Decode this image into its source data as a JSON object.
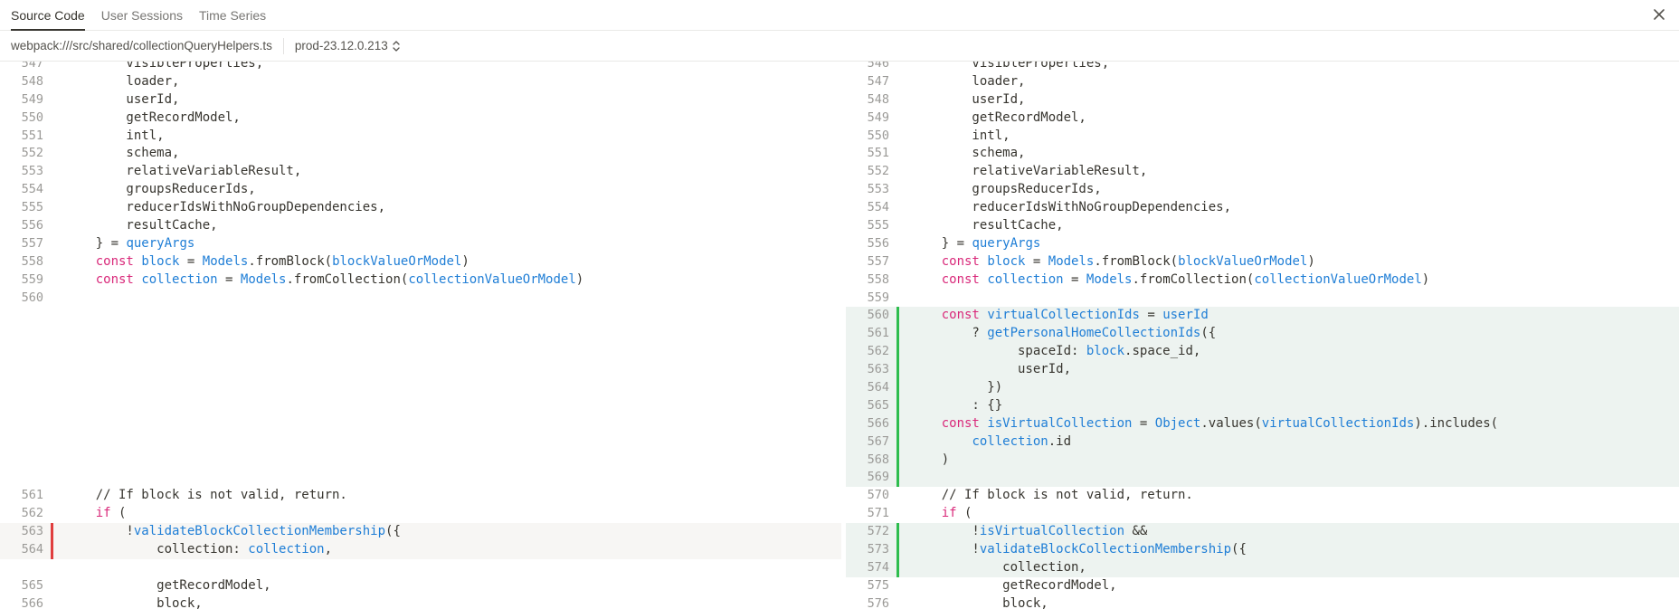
{
  "tabs": [
    {
      "label": "Source Code",
      "active": true
    },
    {
      "label": "User Sessions",
      "active": false
    },
    {
      "label": "Time Series",
      "active": false
    }
  ],
  "file_path": "webpack:///src/shared/collectionQueryHelpers.ts",
  "version": "prod-23.12.0.213",
  "colors": {
    "added": "#2ebd4e",
    "removed": "#e03e3e",
    "keyword": "#d9297a",
    "identifier": "#1f7ed6"
  },
  "left": [
    {
      "n": "547",
      "t": "        visibleProperties,"
    },
    {
      "n": "548",
      "t": "        loader,"
    },
    {
      "n": "549",
      "t": "        userId,"
    },
    {
      "n": "550",
      "t": "        getRecordModel,"
    },
    {
      "n": "551",
      "t": "        intl,"
    },
    {
      "n": "552",
      "t": "        schema,"
    },
    {
      "n": "553",
      "t": "        relativeVariableResult,"
    },
    {
      "n": "554",
      "t": "        groupsReducerIds,"
    },
    {
      "n": "555",
      "t": "        reducerIdsWithNoGroupDependencies,"
    },
    {
      "n": "556",
      "t": "        resultCache,"
    },
    {
      "n": "557",
      "t": "    } = ",
      "parts": [
        {
          "c": "id",
          "t": "queryArgs"
        }
      ]
    },
    {
      "n": "558",
      "parts": [
        {
          "t": "    "
        },
        {
          "c": "kw",
          "t": "const"
        },
        {
          "t": " "
        },
        {
          "c": "id",
          "t": "block"
        },
        {
          "t": " = "
        },
        {
          "c": "id",
          "t": "Models"
        },
        {
          "t": ".fromBlock("
        },
        {
          "c": "id",
          "t": "blockValueOrModel"
        },
        {
          "t": ")"
        }
      ]
    },
    {
      "n": "559",
      "parts": [
        {
          "t": "    "
        },
        {
          "c": "kw",
          "t": "const"
        },
        {
          "t": " "
        },
        {
          "c": "id",
          "t": "collection"
        },
        {
          "t": " = "
        },
        {
          "c": "id",
          "t": "Models"
        },
        {
          "t": ".fromCollection("
        },
        {
          "c": "id",
          "t": "collectionValueOrModel"
        },
        {
          "t": ")"
        }
      ]
    },
    {
      "n": "560",
      "t": ""
    },
    {
      "spacer": true
    },
    {
      "spacer": true
    },
    {
      "spacer": true
    },
    {
      "spacer": true
    },
    {
      "spacer": true
    },
    {
      "spacer": true
    },
    {
      "spacer": true
    },
    {
      "spacer": true
    },
    {
      "spacer": true
    },
    {
      "spacer": true
    },
    {
      "n": "561",
      "t": "    // If block is not valid, return."
    },
    {
      "n": "562",
      "parts": [
        {
          "t": "    "
        },
        {
          "c": "kw",
          "t": "if"
        },
        {
          "t": " ("
        }
      ]
    },
    {
      "n": "563",
      "del": true,
      "parts": [
        {
          "t": "        !"
        },
        {
          "c": "id",
          "t": "validateBlockCollectionMembership"
        },
        {
          "t": "({"
        }
      ]
    },
    {
      "n": "564",
      "del": true,
      "parts": [
        {
          "t": "            collection: "
        },
        {
          "c": "id",
          "t": "collection"
        },
        {
          "t": ","
        }
      ]
    },
    {
      "spacer": true
    },
    {
      "n": "565",
      "t": "            getRecordModel,"
    },
    {
      "n": "566",
      "t": "            block,"
    }
  ],
  "right": [
    {
      "n": "546",
      "t": "        visibleProperties,"
    },
    {
      "n": "547",
      "t": "        loader,"
    },
    {
      "n": "548",
      "t": "        userId,"
    },
    {
      "n": "549",
      "t": "        getRecordModel,"
    },
    {
      "n": "550",
      "t": "        intl,"
    },
    {
      "n": "551",
      "t": "        schema,"
    },
    {
      "n": "552",
      "t": "        relativeVariableResult,"
    },
    {
      "n": "553",
      "t": "        groupsReducerIds,"
    },
    {
      "n": "554",
      "t": "        reducerIdsWithNoGroupDependencies,"
    },
    {
      "n": "555",
      "t": "        resultCache,"
    },
    {
      "n": "556",
      "t": "    } = ",
      "parts": [
        {
          "c": "id",
          "t": "queryArgs"
        }
      ]
    },
    {
      "n": "557",
      "parts": [
        {
          "t": "    "
        },
        {
          "c": "kw",
          "t": "const"
        },
        {
          "t": " "
        },
        {
          "c": "id",
          "t": "block"
        },
        {
          "t": " = "
        },
        {
          "c": "id",
          "t": "Models"
        },
        {
          "t": ".fromBlock("
        },
        {
          "c": "id",
          "t": "blockValueOrModel"
        },
        {
          "t": ")"
        }
      ]
    },
    {
      "n": "558",
      "parts": [
        {
          "t": "    "
        },
        {
          "c": "kw",
          "t": "const"
        },
        {
          "t": " "
        },
        {
          "c": "id",
          "t": "collection"
        },
        {
          "t": " = "
        },
        {
          "c": "id",
          "t": "Models"
        },
        {
          "t": ".fromCollection("
        },
        {
          "c": "id",
          "t": "collectionValueOrModel"
        },
        {
          "t": ")"
        }
      ]
    },
    {
      "n": "559",
      "t": ""
    },
    {
      "n": "560",
      "add": true,
      "parts": [
        {
          "t": "    "
        },
        {
          "c": "kw",
          "t": "const"
        },
        {
          "t": " "
        },
        {
          "c": "id",
          "t": "virtualCollectionIds"
        },
        {
          "t": " = "
        },
        {
          "c": "id",
          "t": "userId"
        }
      ]
    },
    {
      "n": "561",
      "add": true,
      "parts": [
        {
          "t": "        ? "
        },
        {
          "c": "id",
          "t": "getPersonalHomeCollectionIds"
        },
        {
          "t": "({"
        }
      ]
    },
    {
      "n": "562",
      "add": true,
      "parts": [
        {
          "t": "              spaceId: "
        },
        {
          "c": "id",
          "t": "block"
        },
        {
          "t": ".space_id,"
        }
      ]
    },
    {
      "n": "563",
      "add": true,
      "t": "              userId,"
    },
    {
      "n": "564",
      "add": true,
      "t": "          })"
    },
    {
      "n": "565",
      "add": true,
      "t": "        : {}"
    },
    {
      "n": "566",
      "add": true,
      "parts": [
        {
          "t": "    "
        },
        {
          "c": "kw",
          "t": "const"
        },
        {
          "t": " "
        },
        {
          "c": "id",
          "t": "isVirtualCollection"
        },
        {
          "t": " = "
        },
        {
          "c": "id",
          "t": "Object"
        },
        {
          "t": ".values("
        },
        {
          "c": "id",
          "t": "virtualCollectionIds"
        },
        {
          "t": ").includes("
        }
      ]
    },
    {
      "n": "567",
      "add": true,
      "parts": [
        {
          "t": "        "
        },
        {
          "c": "id",
          "t": "collection"
        },
        {
          "t": ".id"
        }
      ]
    },
    {
      "n": "568",
      "add": true,
      "t": "    )"
    },
    {
      "n": "569",
      "add": true,
      "t": ""
    },
    {
      "n": "570",
      "t": "    // If block is not valid, return."
    },
    {
      "n": "571",
      "parts": [
        {
          "t": "    "
        },
        {
          "c": "kw",
          "t": "if"
        },
        {
          "t": " ("
        }
      ]
    },
    {
      "n": "572",
      "add": true,
      "parts": [
        {
          "t": "        !"
        },
        {
          "c": "id",
          "t": "isVirtualCollection"
        },
        {
          "t": " &&"
        }
      ]
    },
    {
      "n": "573",
      "add": true,
      "parts": [
        {
          "t": "        !"
        },
        {
          "c": "id",
          "t": "validateBlockCollectionMembership"
        },
        {
          "t": "({"
        }
      ]
    },
    {
      "n": "574",
      "add": true,
      "t": "            collection,"
    },
    {
      "n": "575",
      "t": "            getRecordModel,"
    },
    {
      "n": "576",
      "t": "            block,"
    }
  ]
}
